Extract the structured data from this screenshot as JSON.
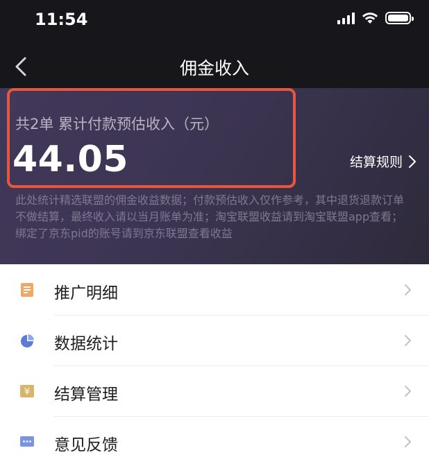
{
  "status_bar": {
    "time": "11:54"
  },
  "nav": {
    "title": "佣金收入"
  },
  "summary": {
    "order_label": "共2单 累计付款预估收入（元）",
    "amount": "44.05",
    "rules_link": "结算规则",
    "disclaimer": "此处统计精选联盟的佣金收益数据；付款预估收入仅作参考，其中退货退款订单不做结算，最终收入请以当月账单为准；淘宝联盟收益请到淘宝联盟app查看；绑定了京东pid的账号请到京东联盟查看收益"
  },
  "menu": {
    "items": [
      {
        "label": "推广明细",
        "icon": "document-icon"
      },
      {
        "label": "数据统计",
        "icon": "pie-chart-icon"
      },
      {
        "label": "结算管理",
        "icon": "yen-icon"
      },
      {
        "label": "意见反馈",
        "icon": "feedback-icon"
      }
    ]
  },
  "colors": {
    "highlight_border": "#e9553d",
    "document_icon": "#f0a868",
    "pie_icon": "#5b7bd6",
    "yen_icon": "#d9b56b",
    "feedback_icon": "#7a95e0"
  }
}
